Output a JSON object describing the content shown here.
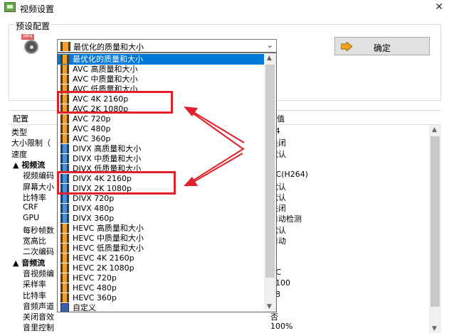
{
  "window": {
    "title": "视频设置"
  },
  "preset": {
    "group_label": "预设配置",
    "selected": "最优化的质量和大小",
    "ok_label": "确定",
    "options": [
      {
        "label": "最优化的质量和大小",
        "icon": "film-icon",
        "selected": true
      },
      {
        "label": "AVC 高质量和大小",
        "icon": "film-icon"
      },
      {
        "label": "AVC 中质量和大小",
        "icon": "film-icon"
      },
      {
        "label": "AVC 低质量和大小",
        "icon": "film-icon"
      },
      {
        "label": "AVC 4K 2160p",
        "icon": "film-icon"
      },
      {
        "label": "AVC 2K 1080p",
        "icon": "film-icon"
      },
      {
        "label": "AVC 720p",
        "icon": "film-icon"
      },
      {
        "label": "AVC 480p",
        "icon": "film-icon"
      },
      {
        "label": "AVC 360p",
        "icon": "film-icon"
      },
      {
        "label": "DIVX 高质量和大小",
        "icon": "divx-icon"
      },
      {
        "label": "DIVX 中质量和大小",
        "icon": "divx-icon"
      },
      {
        "label": "DIVX 低质量和大小",
        "icon": "divx-icon"
      },
      {
        "label": "DIVX 4K 2160p",
        "icon": "divx-icon"
      },
      {
        "label": "DIVX 2K 1080p",
        "icon": "divx-icon"
      },
      {
        "label": "DIVX 720p",
        "icon": "divx-icon"
      },
      {
        "label": "DIVX 480p",
        "icon": "divx-icon"
      },
      {
        "label": "DIVX 360p",
        "icon": "divx-icon"
      },
      {
        "label": "HEVC 高质量和大小",
        "icon": "film-icon"
      },
      {
        "label": "HEVC 中质量和大小",
        "icon": "film-icon"
      },
      {
        "label": "HEVC 低质量和大小",
        "icon": "film-icon"
      },
      {
        "label": "HEVC 4K 2160p",
        "icon": "film-icon"
      },
      {
        "label": "HEVC 2K 1080p",
        "icon": "film-icon"
      },
      {
        "label": "HEVC 720p",
        "icon": "film-icon"
      },
      {
        "label": "HEVC 480p",
        "icon": "film-icon"
      },
      {
        "label": "HEVC 360p",
        "icon": "film-icon"
      },
      {
        "label": "自定义",
        "icon": "custom-icon"
      }
    ]
  },
  "grid": {
    "col_key": "配置",
    "col_value": "数值",
    "rows": [
      {
        "key": "类型",
        "value": "P4",
        "kind": "prop"
      },
      {
        "key": "大小限制（",
        "value": "关闭",
        "kind": "prop"
      },
      {
        "key": "速度",
        "value": "默认",
        "kind": "prop"
      },
      {
        "key": "视频流",
        "value": "",
        "kind": "cat"
      },
      {
        "key": "视频编码",
        "value": "VC(H264)",
        "kind": "sub"
      },
      {
        "key": "屏幕大小",
        "value": "默认",
        "kind": "sub"
      },
      {
        "key": "比特率",
        "value": "默认",
        "kind": "sub"
      },
      {
        "key": "CRF",
        "value": "关闭",
        "kind": "sub"
      },
      {
        "key": "GPU",
        "value": "自动检测",
        "kind": "sub"
      },
      {
        "key": "每秒帧数",
        "value": "默认",
        "kind": "sub"
      },
      {
        "key": "宽高比",
        "value": "自动",
        "kind": "sub"
      },
      {
        "key": "二次编码",
        "value": "",
        "kind": "sub"
      },
      {
        "key": "音频流",
        "value": "",
        "kind": "cat"
      },
      {
        "key": "音视频编",
        "value": "AC",
        "kind": "sub"
      },
      {
        "key": "采样率",
        "value": "4100",
        "kind": "sub"
      },
      {
        "key": "比特率",
        "value": "28",
        "kind": "sub"
      },
      {
        "key": "音频声道",
        "value": "",
        "kind": "sub"
      },
      {
        "key": "关闭音效",
        "value": "否",
        "kind": "sub"
      },
      {
        "key": "音里控制",
        "value": "100%",
        "kind": "sub"
      }
    ]
  },
  "colors": {
    "selection": "#0078d7",
    "annotation": "#e0202a"
  }
}
